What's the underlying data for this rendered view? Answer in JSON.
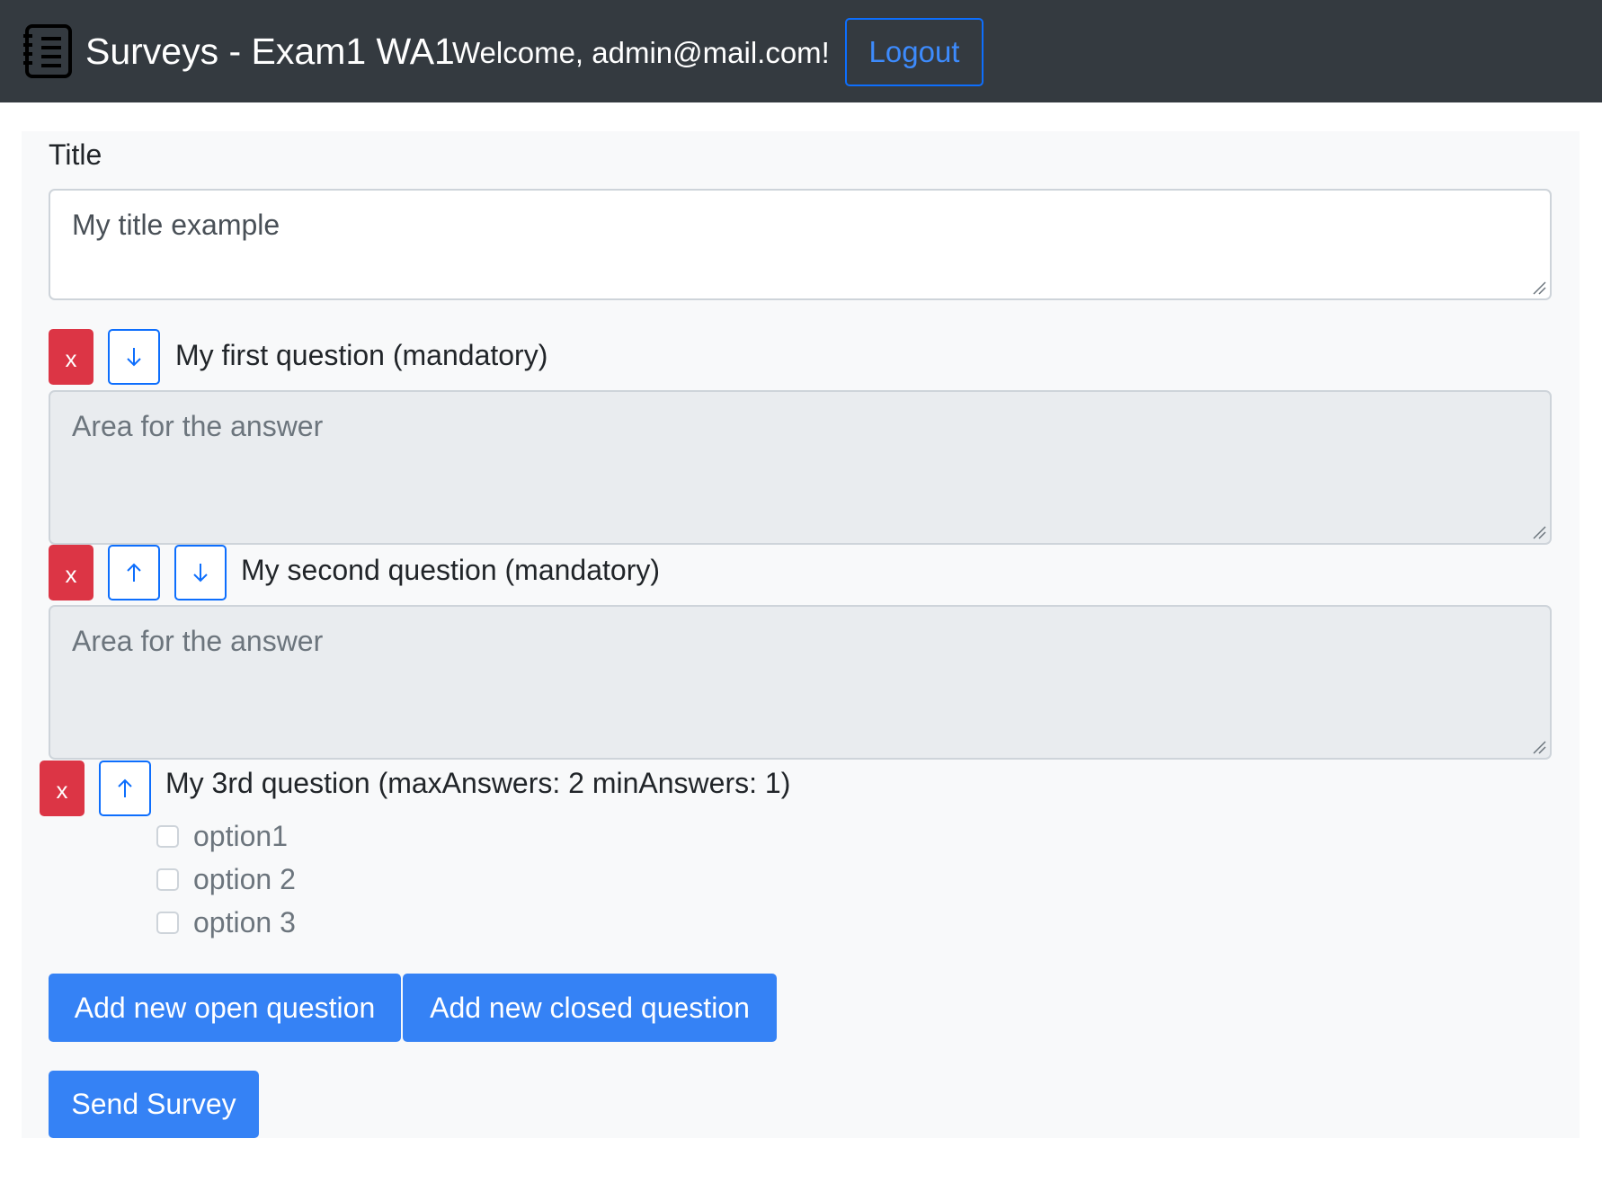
{
  "navbar": {
    "brand_icon": "notebook-list-icon",
    "title": "Surveys - Exam1 WA1",
    "welcome": "Welcome, admin@mail.com!",
    "logout_label": "Logout"
  },
  "form": {
    "title_label": "Title",
    "title_value": "My title example",
    "questions": [
      {
        "label": "My first question (mandatory)",
        "placeholder": "Area for the answer",
        "delete_label": "x",
        "controls": [
          "move-down-icon"
        ]
      },
      {
        "label": "My second question (mandatory)",
        "placeholder": "Area for the answer",
        "delete_label": "x",
        "controls": [
          "move-up-icon",
          "move-down-icon"
        ]
      },
      {
        "label": "My 3rd question (maxAnswers: 2 minAnswers: 1)",
        "delete_label": "x",
        "controls": [
          "move-up-icon"
        ],
        "options": [
          "option1",
          "option 2",
          "option 3"
        ]
      }
    ],
    "add_open_label": "Add new open question",
    "add_closed_label": "Add new closed question",
    "send_label": "Send Survey"
  },
  "colors": {
    "navbar_bg": "#343a40",
    "primary": "#3582f5",
    "danger": "#dc3545",
    "panel_bg": "#f8f9fa"
  }
}
